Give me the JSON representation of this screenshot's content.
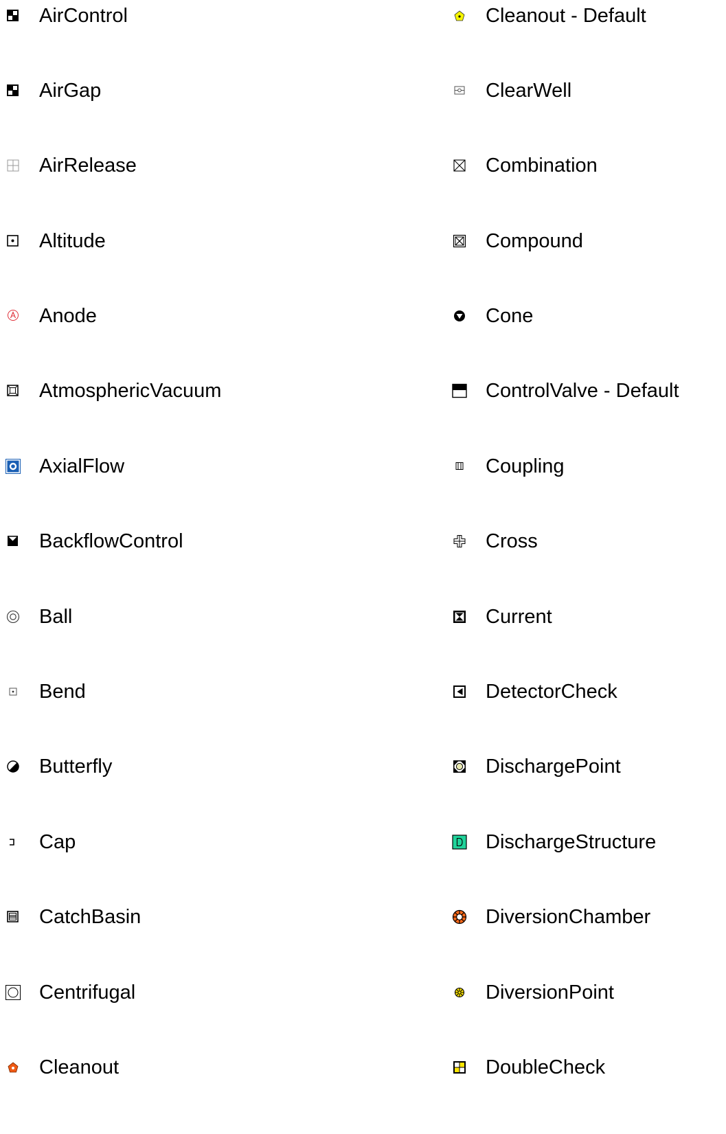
{
  "legend": {
    "left_column": [
      {
        "label": "AirControl",
        "icon": "air-control-icon"
      },
      {
        "label": "AirGap",
        "icon": "air-gap-icon"
      },
      {
        "label": "AirRelease",
        "icon": "air-release-icon"
      },
      {
        "label": "Altitude",
        "icon": "altitude-icon"
      },
      {
        "label": "Anode",
        "icon": "anode-icon"
      },
      {
        "label": "AtmosphericVacuum",
        "icon": "atmospheric-vacuum-icon"
      },
      {
        "label": "AxialFlow",
        "icon": "axial-flow-icon"
      },
      {
        "label": "BackflowControl",
        "icon": "backflow-control-icon"
      },
      {
        "label": "Ball",
        "icon": "ball-icon"
      },
      {
        "label": "Bend",
        "icon": "bend-icon"
      },
      {
        "label": "Butterfly",
        "icon": "butterfly-icon"
      },
      {
        "label": "Cap",
        "icon": "cap-icon"
      },
      {
        "label": "CatchBasin",
        "icon": "catch-basin-icon"
      },
      {
        "label": "Centrifugal",
        "icon": "centrifugal-icon"
      },
      {
        "label": "Cleanout",
        "icon": "cleanout-icon"
      }
    ],
    "right_column": [
      {
        "label": "Cleanout - Default",
        "icon": "cleanout-default-icon"
      },
      {
        "label": "ClearWell",
        "icon": "clear-well-icon"
      },
      {
        "label": "Combination",
        "icon": "combination-icon"
      },
      {
        "label": "Compound",
        "icon": "compound-icon"
      },
      {
        "label": "Cone",
        "icon": "cone-icon"
      },
      {
        "label": "ControlValve - Default",
        "icon": "control-valve-default-icon"
      },
      {
        "label": "Coupling",
        "icon": "coupling-icon"
      },
      {
        "label": "Cross",
        "icon": "cross-icon"
      },
      {
        "label": "Current",
        "icon": "current-icon"
      },
      {
        "label": "DetectorCheck",
        "icon": "detector-check-icon"
      },
      {
        "label": "DischargePoint",
        "icon": "discharge-point-icon"
      },
      {
        "label": "DischargeStructure",
        "icon": "discharge-structure-icon"
      },
      {
        "label": "DiversionChamber",
        "icon": "diversion-chamber-icon"
      },
      {
        "label": "DiversionPoint",
        "icon": "diversion-point-icon"
      },
      {
        "label": "DoubleCheck",
        "icon": "double-check-icon"
      }
    ]
  },
  "colors": {
    "text": "#000000",
    "background": "#ffffff",
    "anode_red": "#e0303a",
    "axial_flow_blue": "#1a5fb4",
    "cleanout_orange": "#f05a14",
    "cleanout_default_yellow": "#f5f500",
    "discharge_point_fill": "#e8e8b0",
    "discharge_structure_green": "#1fd39a",
    "diversion_chamber_orange": "#ff6a1a",
    "diversion_point_yellow": "#ffe600",
    "double_check_yellow": "#ffe600"
  }
}
